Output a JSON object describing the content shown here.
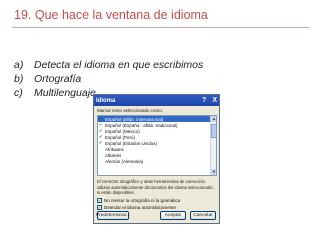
{
  "slide": {
    "title": "19. Que hace la ventana de idioma",
    "options": [
      {
        "marker": "a)",
        "text": "Detecta el idioma  en que escribimos"
      },
      {
        "marker": "b)",
        "text": "Ortografía"
      },
      {
        "marker": "c)",
        "text": "Multilenguaje"
      }
    ]
  },
  "dialog": {
    "title": "Idioma",
    "help_label": "?",
    "close_label": "X",
    "list_label": "Marcar texto seleccionado como:",
    "languages": [
      {
        "name": "Español (alfab. internacional)",
        "spell": true,
        "selected": true
      },
      {
        "name": "Español (España - alfab. tradicional)",
        "spell": true,
        "selected": false
      },
      {
        "name": "Español (México)",
        "spell": true,
        "selected": false
      },
      {
        "name": "Español (Perú)",
        "spell": true,
        "selected": false
      },
      {
        "name": "Español (Estados Unidos)",
        "spell": true,
        "selected": false
      },
      {
        "name": "Afrikaans",
        "spell": false,
        "selected": false
      },
      {
        "name": "Albanés",
        "spell": false,
        "selected": false
      },
      {
        "name": "Alemán (Alemania)",
        "spell": false,
        "selected": false
      }
    ],
    "note": "El corrector ortográfico y otras herramientas de corrección utilizan automáticamente diccionarios del idioma seleccionado, si están disponibles.",
    "checkboxes": [
      {
        "label": "No revisar la ortografía ni la gramática",
        "checked": true
      },
      {
        "label": "Detectar el idioma automáticamente",
        "checked": true
      }
    ],
    "buttons": {
      "default": "Predeterminar...",
      "ok": "Aceptar",
      "cancel": "Cancelar"
    }
  },
  "colors": {
    "title_red": "#c0504d",
    "titlebar_blue": "#1d44a8",
    "selection_blue": "#316ac5",
    "dialog_bg": "#ece9d8"
  }
}
